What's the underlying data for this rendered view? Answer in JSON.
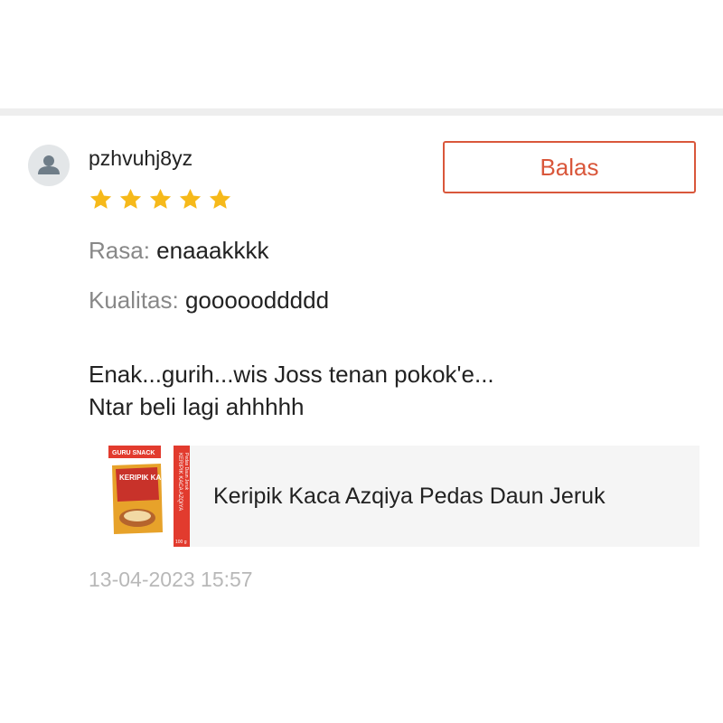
{
  "review": {
    "username": "pzhvuhj8yz",
    "reply_label": "Balas",
    "rating": 5,
    "attributes": [
      {
        "key": "Rasa:",
        "value": "enaaakkkk"
      },
      {
        "key": "Kualitas:",
        "value": "goooooddddd"
      }
    ],
    "comment_lines": [
      "Enak...gurih...wis Joss tenan pokok'e...",
      "Ntar beli lagi ahhhhh"
    ],
    "product": {
      "name": "Keripik Kaca Azqiya Pedas Daun Jeruk",
      "thumbnail_texts": {
        "brand": "GURU SNACK",
        "title": "KERIPIK KACA AZQIYA",
        "side_title": "KERIPIK KACA AZQIYA",
        "side_sub": "Pedas Daun Jeruk",
        "weight": "100 g"
      }
    },
    "timestamp": "13-04-2023 15:57"
  },
  "colors": {
    "accent": "#d9573b",
    "star": "#f6b91a",
    "muted": "#888888",
    "timestamp": "#b8b8b8"
  },
  "icons": {
    "avatar": "person-icon",
    "star": "star-icon"
  }
}
